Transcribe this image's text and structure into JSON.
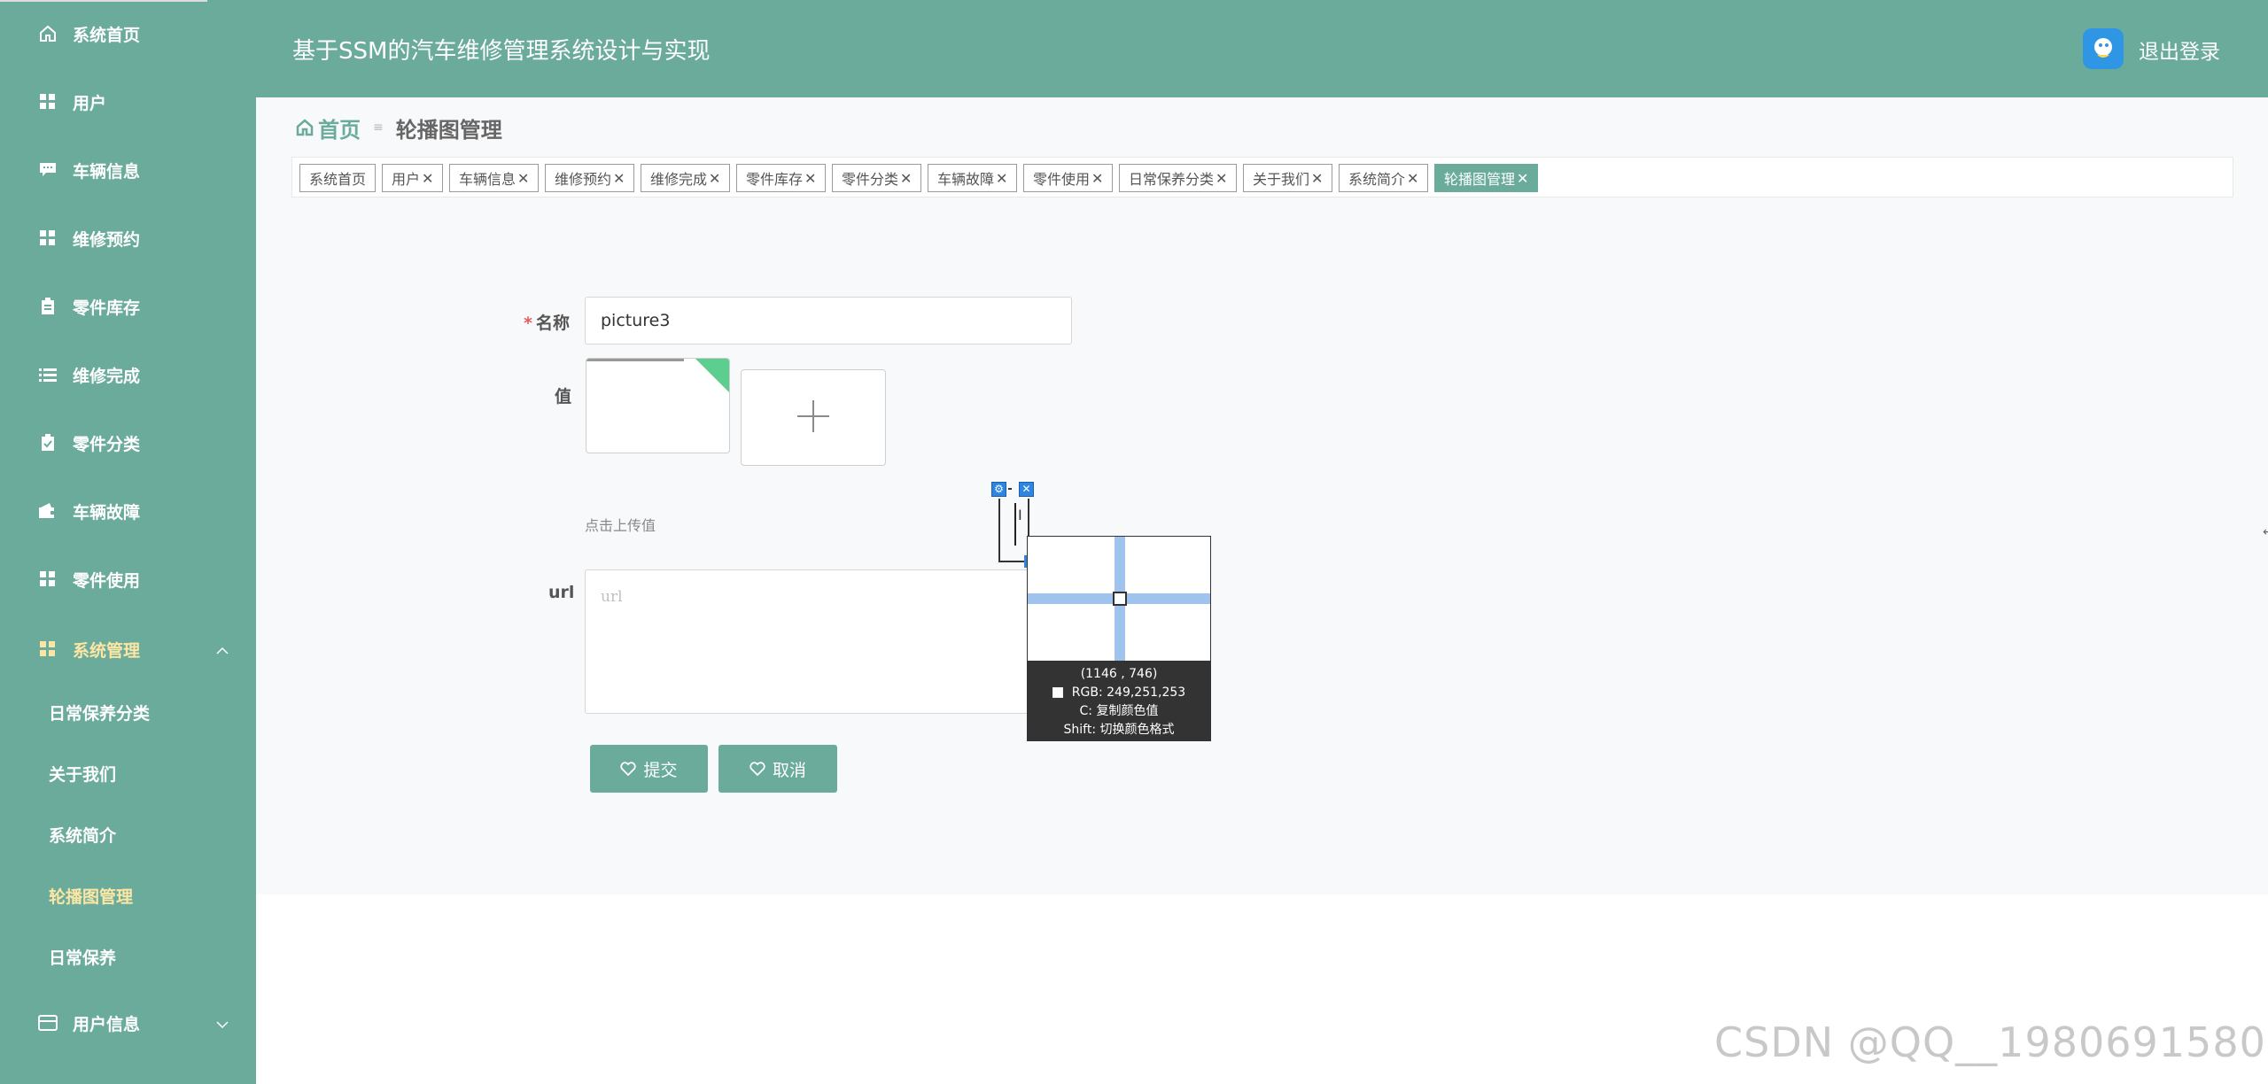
{
  "sidebar": {
    "items": [
      {
        "label": "系统首页",
        "icon": "home-icon"
      },
      {
        "label": "用户",
        "icon": "grid-icon"
      },
      {
        "label": "车辆信息",
        "icon": "chat-icon"
      },
      {
        "label": "维修预约",
        "icon": "grid-icon"
      },
      {
        "label": "零件库存",
        "icon": "clipboard-icon"
      },
      {
        "label": "维修完成",
        "icon": "list-icon"
      },
      {
        "label": "零件分类",
        "icon": "checklist-icon"
      },
      {
        "label": "车辆故障",
        "icon": "wallet-icon"
      },
      {
        "label": "零件使用",
        "icon": "grid-icon"
      },
      {
        "label": "系统管理",
        "icon": "grid-icon",
        "expanded": true
      }
    ],
    "sub_items": [
      {
        "label": "日常保养分类"
      },
      {
        "label": "关于我们"
      },
      {
        "label": "系统简介"
      },
      {
        "label": "轮播图管理",
        "active": true
      },
      {
        "label": "日常保养"
      }
    ],
    "user_info": {
      "label": "用户信息",
      "icon": "card-icon"
    }
  },
  "header": {
    "title": "基于SSM的汽车维修管理系统设计与实现",
    "logout_label": "退出登录"
  },
  "breadcrumb": {
    "home": "首页",
    "separator": "≡",
    "current": "轮播图管理"
  },
  "tags": [
    {
      "label": "系统首页",
      "closable": false
    },
    {
      "label": "用户",
      "closable": true
    },
    {
      "label": "车辆信息",
      "closable": true
    },
    {
      "label": "维修预约",
      "closable": true
    },
    {
      "label": "维修完成",
      "closable": true
    },
    {
      "label": "零件库存",
      "closable": true
    },
    {
      "label": "零件分类",
      "closable": true
    },
    {
      "label": "车辆故障",
      "closable": true
    },
    {
      "label": "零件使用",
      "closable": true
    },
    {
      "label": "日常保养分类",
      "closable": true
    },
    {
      "label": "关于我们",
      "closable": true
    },
    {
      "label": "系统简介",
      "closable": true
    },
    {
      "label": "轮播图管理",
      "closable": true,
      "active": true
    }
  ],
  "form": {
    "name_label": "名称",
    "name_required_mark": "*",
    "name_value": "picture3",
    "value_label": "值",
    "upload_hint": "点击上传值",
    "url_label": "url",
    "url_placeholder": "url",
    "submit_label": "提交",
    "cancel_label": "取消"
  },
  "color_picker": {
    "coords": "(1146 ,  746)",
    "rgb": "RGB: 249,251,253",
    "copy_hint": "C: 复制颜色值",
    "shift_hint": "Shift: 切换颜色格式",
    "sampled_color": "#f9fbfd"
  },
  "watermark": "CSDN @QQ__1980691580",
  "colors": {
    "accent": "#6aab9c",
    "active_sub": "#fbe6a3",
    "required": "#e85c5c"
  }
}
